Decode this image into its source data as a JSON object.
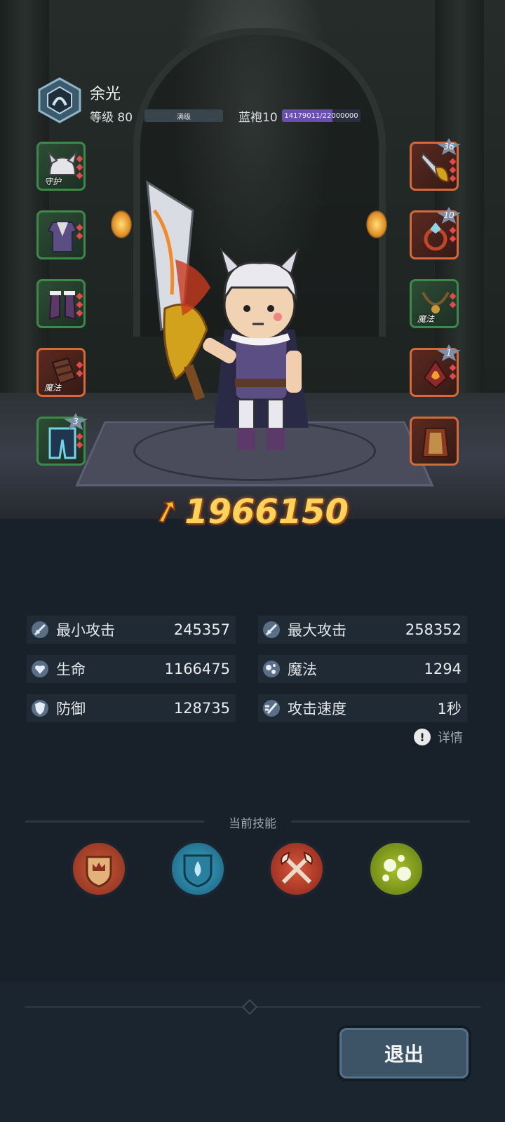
{
  "player": {
    "name": "余光",
    "level_label": "等级 80",
    "level_status": "满级",
    "rank_label": "蓝袍10",
    "rank_progress_text": "14179011/22000000",
    "rank_progress": 0.6445
  },
  "equipment": {
    "left": [
      {
        "tag": "守护",
        "stars": ""
      },
      {
        "tag": "",
        "stars": ""
      },
      {
        "tag": "",
        "stars": ""
      },
      {
        "tag": "魔法",
        "stars": ""
      },
      {
        "tag": "",
        "stars": "3"
      }
    ],
    "right": [
      {
        "tag": "",
        "stars": "36"
      },
      {
        "tag": "",
        "stars": "10"
      },
      {
        "tag": "魔法",
        "stars": ""
      },
      {
        "tag": "",
        "stars": "1"
      },
      {
        "tag": "",
        "stars": ""
      }
    ]
  },
  "combat_power": "1966150",
  "stats": {
    "min_attack": {
      "label": "最小攻击",
      "value": "245357"
    },
    "max_attack": {
      "label": "最大攻击",
      "value": "258352"
    },
    "hp": {
      "label": "生命",
      "value": "1166475"
    },
    "magic": {
      "label": "魔法",
      "value": "1294"
    },
    "defense": {
      "label": "防御",
      "value": "128735"
    },
    "attack_speed": {
      "label": "攻击速度",
      "value": "1秒"
    }
  },
  "details_label": "详情",
  "skills": {
    "title": "当前技能",
    "items": [
      {
        "icon": "crown-shield-icon",
        "color": "#a8432a"
      },
      {
        "icon": "water-shield-icon",
        "color": "#2c8fb0"
      },
      {
        "icon": "crossed-axes-icon",
        "color": "#c0402a"
      },
      {
        "icon": "bubbles-icon",
        "color": "#8fae22"
      }
    ]
  },
  "exit_label": "退出"
}
